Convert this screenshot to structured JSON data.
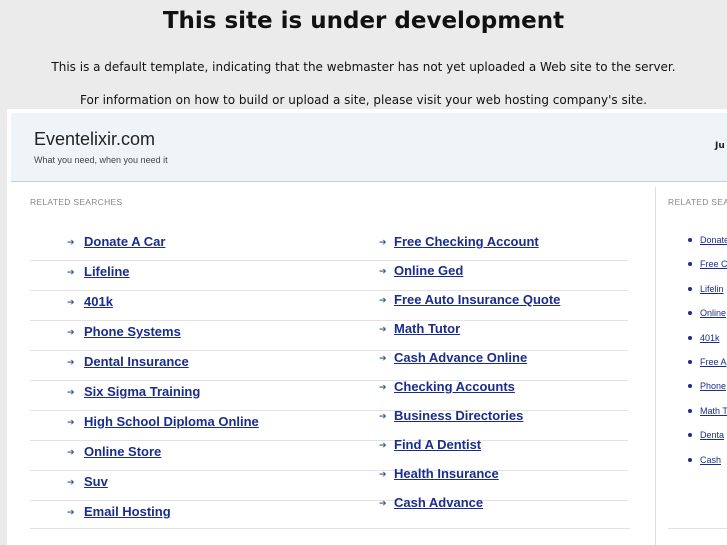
{
  "notice": {
    "title": "This site is under development",
    "line1": "This is a default template, indicating that the webmaster has not yet uploaded a Web site to the server.",
    "line2": "For information on how to build or upload a site, please visit your web hosting company's site."
  },
  "site": {
    "name": "Eventelixir.com",
    "tagline": "What you need, when you need it",
    "header_right": "Ju"
  },
  "main": {
    "section_label": "RELATED SEARCHES",
    "left_links": [
      "Donate A Car",
      "Lifeline",
      "401k",
      "Phone Systems",
      "Dental Insurance",
      "Six Sigma Training",
      "High School Diploma Online",
      "Online Store",
      "Suv",
      "Email Hosting"
    ],
    "right_links": [
      "Free Checking Account",
      "Online Ged",
      "Free Auto Insurance Quote",
      "Math Tutor",
      "Cash Advance Online",
      "Checking Accounts",
      "Business Directories",
      "Find A Dentist",
      "Health Insurance",
      "Cash Advance"
    ]
  },
  "sidebar": {
    "section_label": "RELATED SEA",
    "links": [
      "Donate",
      "Free C",
      "Lifelin",
      "Online",
      "401k",
      "Free A",
      "Phone",
      "Math T",
      "Denta",
      "Cash"
    ]
  },
  "colors": {
    "link": "#1a2d8c",
    "header_bg": "#eef4f8",
    "page_bg": "#ebebeb"
  }
}
